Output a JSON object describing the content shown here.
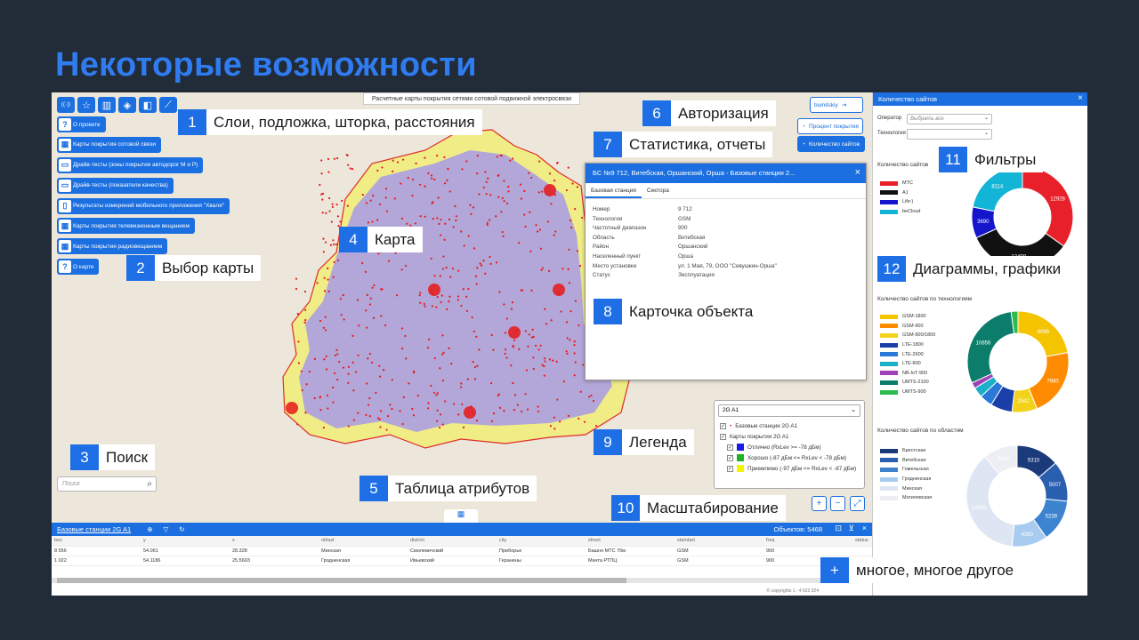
{
  "slide_title": "Некоторые возможности",
  "map": {
    "top_banner": "Расчетные карты покрытия сетями сотовой подвижной электросвязи",
    "toolbar_icons": [
      "antenna-icon",
      "star-icon",
      "map-icon",
      "layers-icon",
      "split-icon",
      "ruler-icon"
    ],
    "menu": [
      {
        "icon": "?",
        "label": "О проекте"
      },
      {
        "icon": "▦",
        "label": "Карты покрытия сотовой связи"
      },
      {
        "icon": "▭",
        "label": "Драйв-тесты (зоны покрытия автодорог М и Р)"
      },
      {
        "icon": "▭",
        "label": "Драйв-тесты (показатели качества)"
      },
      {
        "icon": "▯",
        "label": "Результаты измерений мобильного приложения \"Хваля\""
      },
      {
        "icon": "▦",
        "label": "Карты покрытия телевизионным вещанием"
      },
      {
        "icon": "▦",
        "label": "Карты покрытия радиовещанием"
      },
      {
        "icon": "?",
        "label": "О карте"
      }
    ],
    "user": "buinitskiy",
    "btn_percent": "Процент покрытия",
    "btn_count": "Количество сайтов",
    "search_placeholder": "Поиск",
    "table_toggle": "▦"
  },
  "card": {
    "title": "БС №9 712, Витебская, Оршанский, Орша - Базовые станции 2...",
    "tabs": [
      "Базовая станция",
      "Сектора"
    ],
    "rows": [
      {
        "k": "Номер",
        "v": "9 712"
      },
      {
        "k": "Технология",
        "v": "GSM"
      },
      {
        "k": "Частотный диапазон",
        "v": "900"
      },
      {
        "k": "Область",
        "v": "Витебская"
      },
      {
        "k": "Район",
        "v": "Оршанский"
      },
      {
        "k": "Населенный пункт",
        "v": "Орша"
      },
      {
        "k": "Место установки",
        "v": "ул. 1 Мая, 79, ООО \"Севушкин-Орша\""
      },
      {
        "k": "Статус",
        "v": "Эксплуатация"
      }
    ]
  },
  "legend": {
    "select": "2G A1",
    "items": [
      {
        "label": "Базовые станции 2G A1",
        "color": "#e02020",
        "kind": "dot",
        "indent": false
      },
      {
        "label": "Карты покрытия 2G A1",
        "color": "",
        "kind": "none",
        "indent": false
      },
      {
        "label": "Отлично (RxLev >= -78 дБм)",
        "color": "#1a1ae6",
        "kind": "sw",
        "indent": true
      },
      {
        "label": "Хорошо (-87 дБм <= RxLev < -78 дБм)",
        "color": "#22b122",
        "kind": "sw",
        "indent": true
      },
      {
        "label": "Приемлемо (-97 дБм <= RxLev < -87 дБм)",
        "color": "#f5f500",
        "kind": "sw",
        "indent": true
      }
    ]
  },
  "attr": {
    "title": "Базовые станции 2G A1",
    "count": "Объектов: 5468",
    "columns": [
      "bsn",
      "y",
      "x",
      "oblast",
      "district",
      "city",
      "street",
      "standart",
      "freq",
      "status"
    ],
    "rows": [
      [
        "8 556",
        "54.061",
        "28.328",
        "Минская",
        "Смолевичский",
        "Приборье",
        "Башня МТС 70м",
        "GSM",
        "900",
        ""
      ],
      [
        "1 022",
        "54.1186",
        "25.5603",
        "Гродненская",
        "Ивьевский",
        "Геранены",
        "Мачта РТПЦ",
        "GSM",
        "900",
        ""
      ]
    ],
    "footer": "© copyrights      1 : 4 622 324"
  },
  "panel": {
    "title": "Количество сайтов",
    "operator_label": "Оператор",
    "operator_value": "Выбрать все",
    "tech_label": "Технология",
    "tech_value": ""
  },
  "chart_data": [
    {
      "type": "pie",
      "title": "Количество сайтов",
      "categories": [
        "МТС",
        "A1",
        "Life:)",
        "beCloud"
      ],
      "values": [
        12928,
        12400,
        3690,
        8114
      ],
      "colors": [
        "#e8202a",
        "#111111",
        "#1515cc",
        "#12b5d6"
      ]
    },
    {
      "type": "pie",
      "title": "Количество сайтов по технологиям",
      "categories": [
        "GSM-1800",
        "GSM-900",
        "GSM-900/1800",
        "LTE-1800",
        "LTE-2600",
        "LTE-800",
        "NB-IoT-900",
        "UMTS-2100",
        "UMTS-900"
      ],
      "values": [
        8085,
        7980,
        2942,
        2557,
        1500,
        1200,
        700,
        10856,
        800
      ],
      "colors": [
        "#f5c400",
        "#ff8c00",
        "#f2d21a",
        "#1a3fa8",
        "#2a78d8",
        "#1ab0c8",
        "#a040b8",
        "#0b7d6a",
        "#2bbb4c"
      ]
    },
    {
      "type": "pie",
      "title": "Количество сайтов по областям",
      "categories": [
        "Брестская",
        "Витебская",
        "Гомельская",
        "Гродненская",
        "Минская",
        "Могилевская"
      ],
      "values": [
        5310,
        5007,
        5239,
        4390,
        14505,
        4200
      ],
      "colors": [
        "#1a3a7a",
        "#2a5fb0",
        "#3c84d0",
        "#a8ccf0",
        "#dde6f2",
        "#eceef3"
      ]
    }
  ],
  "callouts": [
    {
      "n": "1",
      "t": "Слои, подложка, шторка, расстояния"
    },
    {
      "n": "2",
      "t": "Выбор карты"
    },
    {
      "n": "3",
      "t": "Поиск"
    },
    {
      "n": "4",
      "t": "Карта"
    },
    {
      "n": "5",
      "t": "Таблица атрибутов"
    },
    {
      "n": "6",
      "t": "Авторизация"
    },
    {
      "n": "7",
      "t": "Статистика, отчеты"
    },
    {
      "n": "8",
      "t": "Карточка объекта"
    },
    {
      "n": "9",
      "t": "Легенда"
    },
    {
      "n": "10",
      "t": "Масштабирование"
    },
    {
      "n": "11",
      "t": "Фильтры"
    },
    {
      "n": "12",
      "t": "Диаграммы, графики"
    },
    {
      "n": "+",
      "t": "многое, многое другое"
    }
  ]
}
